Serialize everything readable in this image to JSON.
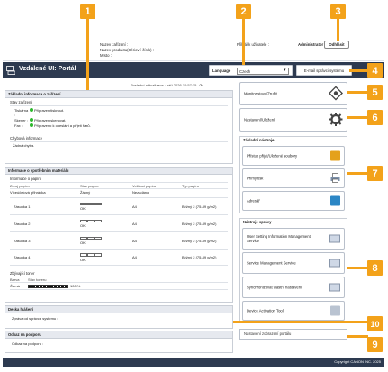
{
  "header": {
    "device_name_label": "Název zařízení :",
    "product_name_label": "Název produktu(Sériové číslo) :",
    "location_label": "Místo :",
    "login_user_label": "Přihlášk uživatele :",
    "login_user_value": "Administrator",
    "logout_label": "Odhlásit"
  },
  "topbar": {
    "title": "Vzdálené UI: Portál",
    "language_label": "Language",
    "language_value": "Czech",
    "email_admin_label": "E-mail správci systému"
  },
  "update": {
    "text": "Poslední aktualizace : září 2026 10:57:15"
  },
  "basic_info": {
    "title": "Základní informace o zařízení",
    "status_title": "Stav zařízení",
    "rows": [
      {
        "label": "Tiskárna :",
        "status": "Připraven tisknout."
      },
      {
        "label": "Skener :",
        "status": "Připraven skenovat."
      },
      {
        "label": "Fax :",
        "status": "Připraveno k odeslání a přijetí faxů."
      }
    ],
    "error_title": "Chybová informace",
    "error_value": "Žádná chyba."
  },
  "consumables": {
    "title": "Informace o spotřebním materiálu",
    "paper_title": "Informace o papíru",
    "columns": [
      "Zdroj papíru",
      "Stav papíru",
      "Velikost papíru",
      "Typ papíru"
    ],
    "rows": [
      {
        "source": "Víceúčelová přihrádka",
        "status": "Žádný",
        "size": "Nezadáno",
        "type": ""
      },
      {
        "source": "Zásuvka 1",
        "status": "OK",
        "size": "A4",
        "type": "Běžný 2 (75-89 g/m2)"
      },
      {
        "source": "Zásuvka 2",
        "status": "OK",
        "size": "A4",
        "type": "Běžný 2 (75-89 g/m2)"
      },
      {
        "source": "Zásuvka 3",
        "status": "OK",
        "size": "A4",
        "type": "Běžný 2 (75-89 g/m2)"
      },
      {
        "source": "Zásuvka 4",
        "status": "OK",
        "size": "A4",
        "type": "Běžný 2 (75-89 g/m2)"
      }
    ],
    "toner_title": "Zbývající toner",
    "toner_columns": [
      "Barva",
      "Stav toneru"
    ],
    "toner_color": "Černá",
    "toner_percent": "100 %",
    "toner_level": 1.0
  },
  "board": {
    "title": "Deska hlášení",
    "label": "Zpráva od správce systému :"
  },
  "support": {
    "title": "Odkaz na podporu",
    "label": "Odkaz na podporu :"
  },
  "right": {
    "monitor_label": "Monitor stavu/Zrušit",
    "settings_label": "Nastavení/Uložení",
    "basic_tools_title": "Základní nástroje",
    "basic_tools": [
      "Přístup přijat/Uložené soubory",
      "Přímý tisk",
      "Adresář"
    ],
    "mgmt_tools_title": "Nástroje správy",
    "mgmt_tools": [
      "User Setting Information Management Service",
      "Service Management Service",
      "Synchronizovat vlastní nastavení",
      "Device Activation Tool"
    ],
    "portal_link": "Nastavení zobrazení portálu"
  },
  "footer": {
    "copyright": "Copyright CANON INC. 2025"
  },
  "callouts": [
    "1",
    "2",
    "3",
    "4",
    "5",
    "6",
    "7",
    "8",
    "9",
    "10"
  ],
  "colors": {
    "callout": "#f3a21a",
    "topbar": "#2d3a50",
    "footer": "#2d3a50",
    "status_ok": "#2eb82e"
  }
}
